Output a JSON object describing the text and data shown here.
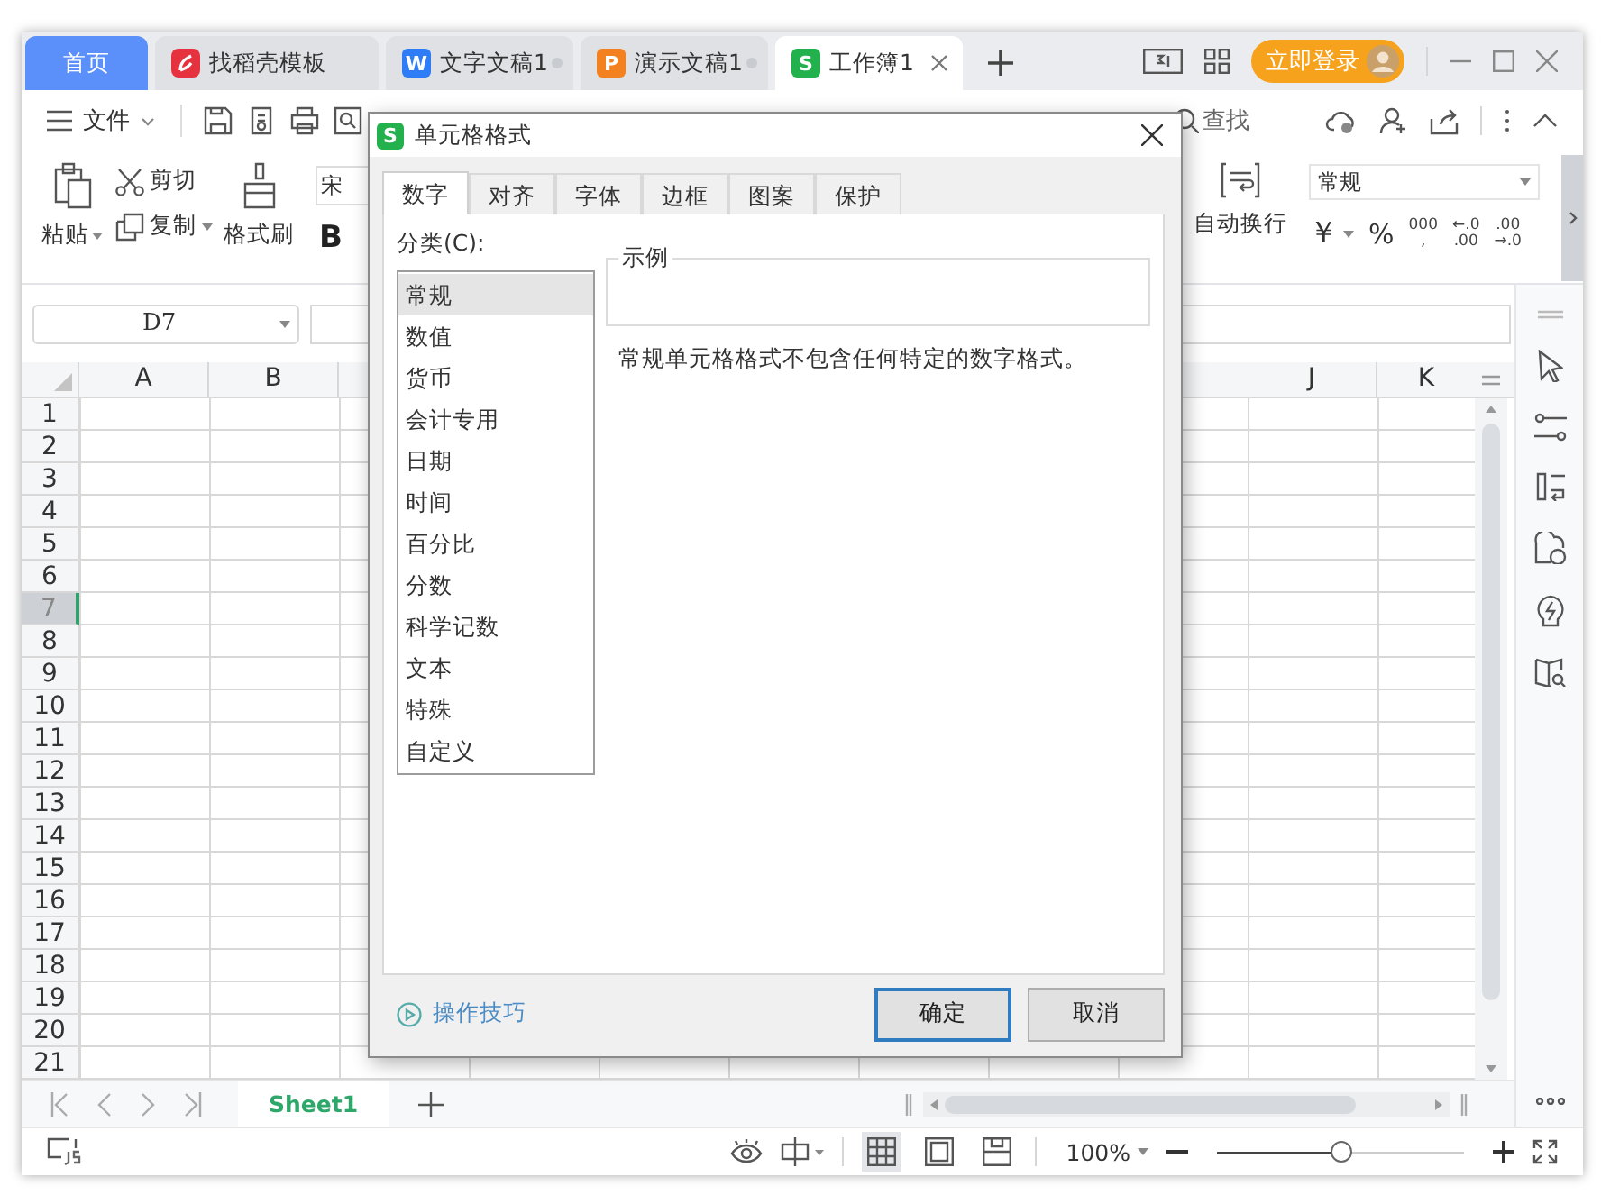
{
  "title_tabs": [
    {
      "kind": "home",
      "label": "首页",
      "selected": false,
      "modified": false
    },
    {
      "kind": "template",
      "label": "找稻壳模板",
      "selected": false,
      "modified": false
    },
    {
      "kind": "writer",
      "icon_letter": "W",
      "label": "文字文稿1",
      "selected": false,
      "modified": true
    },
    {
      "kind": "presentation",
      "icon_letter": "P",
      "label": "演示文稿1",
      "selected": false,
      "modified": true
    },
    {
      "kind": "spreadsheet",
      "icon_letter": "S",
      "label": "工作簿1",
      "selected": true,
      "modified": false
    }
  ],
  "login_button": {
    "label": "立即登录"
  },
  "toolbar": {
    "file_menu": "文件",
    "find": "查找"
  },
  "ribbon": {
    "paste": "粘贴",
    "cut": "剪切",
    "copy": "复制",
    "format_painter": "格式刷",
    "font_name": "宋",
    "bold": "B",
    "wrap_text": "自动换行",
    "number_format": "常规",
    "currency": "￥",
    "percent": "%",
    "thousands": [
      "000",
      ","
    ],
    "decimal_increase": [
      "←.0",
      ".00"
    ],
    "decimal_decrease": [
      ".00",
      "→.0"
    ]
  },
  "formula_bar": {
    "name_box": "D7"
  },
  "sheet": {
    "columns_left": [
      "A",
      "B"
    ],
    "columns_right": [
      "J",
      "K"
    ],
    "rows": [
      {
        "label": "1",
        "selected": false
      },
      {
        "label": "2",
        "selected": false
      },
      {
        "label": "3",
        "selected": false
      },
      {
        "label": "4",
        "selected": false
      },
      {
        "label": "5",
        "selected": false
      },
      {
        "label": "6",
        "selected": false
      },
      {
        "label": "7",
        "selected": true
      },
      {
        "label": "8",
        "selected": false
      },
      {
        "label": "9",
        "selected": false
      },
      {
        "label": "10",
        "selected": false
      },
      {
        "label": "11",
        "selected": false
      },
      {
        "label": "12",
        "selected": false
      },
      {
        "label": "13",
        "selected": false
      },
      {
        "label": "14",
        "selected": false
      },
      {
        "label": "15",
        "selected": false
      },
      {
        "label": "16",
        "selected": false
      },
      {
        "label": "17",
        "selected": false
      },
      {
        "label": "18",
        "selected": false
      },
      {
        "label": "19",
        "selected": false
      },
      {
        "label": "20",
        "selected": false
      },
      {
        "label": "21",
        "selected": false
      }
    ]
  },
  "sheet_tabs": [
    {
      "label": "Sheet1",
      "selected": true
    }
  ],
  "status_bar": {
    "views": [
      {
        "kind": "normal",
        "selected": true
      },
      {
        "kind": "page_layout",
        "selected": false
      },
      {
        "kind": "page_break",
        "selected": false
      }
    ],
    "zoom": "100%",
    "zoom_slider": {
      "level": 0.5
    }
  },
  "dialog": {
    "title_icon_letter": "S",
    "title": "单元格格式",
    "tabs": [
      {
        "label": "数字",
        "selected": true
      },
      {
        "label": "对齐",
        "selected": false
      },
      {
        "label": "字体",
        "selected": false
      },
      {
        "label": "边框",
        "selected": false
      },
      {
        "label": "图案",
        "selected": false
      },
      {
        "label": "保护",
        "selected": false
      }
    ],
    "category_label": "分类(C):",
    "categories": [
      {
        "label": "常规",
        "selected": true
      },
      {
        "label": "数值",
        "selected": false
      },
      {
        "label": "货币",
        "selected": false
      },
      {
        "label": "会计专用",
        "selected": false
      },
      {
        "label": "日期",
        "selected": false
      },
      {
        "label": "时间",
        "selected": false
      },
      {
        "label": "百分比",
        "selected": false
      },
      {
        "label": "分数",
        "selected": false
      },
      {
        "label": "科学记数",
        "selected": false
      },
      {
        "label": "文本",
        "selected": false
      },
      {
        "label": "特殊",
        "selected": false
      },
      {
        "label": "自定义",
        "selected": false
      }
    ],
    "sample_label": "示例",
    "description": "常规单元格格式不包含任何特定的数字格式。",
    "tips_link": "操作技巧",
    "buttons": [
      {
        "label": "确定",
        "default": true
      },
      {
        "label": "取消",
        "default": false
      }
    ]
  }
}
